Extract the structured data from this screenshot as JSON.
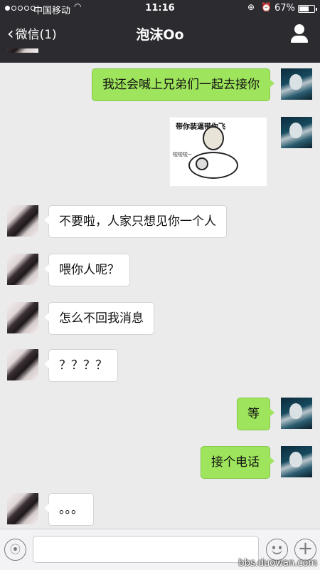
{
  "status_bar": {
    "carrier": "中国移动",
    "time": "11:16",
    "battery": "67%",
    "battery_level": 0.67
  },
  "nav": {
    "back_label": "微信(1)",
    "title": "泡沫Oo"
  },
  "messages": [
    {
      "from": "me",
      "text": "我还会喊上兄弟们一起去接你"
    },
    {
      "from": "me",
      "type": "sticker",
      "caption": "带你装逼带你飞",
      "sub": "啦啦啦~"
    },
    {
      "from": "her",
      "text": "不要啦，人家只想见你一个人"
    },
    {
      "from": "her",
      "text": "喂你人呢？"
    },
    {
      "from": "her",
      "text": "怎么不回我消息"
    },
    {
      "from": "her",
      "text": "？？？？"
    },
    {
      "from": "me",
      "text": "等"
    },
    {
      "from": "me",
      "text": "接个电话"
    },
    {
      "from": "her",
      "text": "。。。"
    }
  ],
  "input": {
    "value": "",
    "placeholder": ""
  },
  "watermark": "bbs.duowan.com"
}
